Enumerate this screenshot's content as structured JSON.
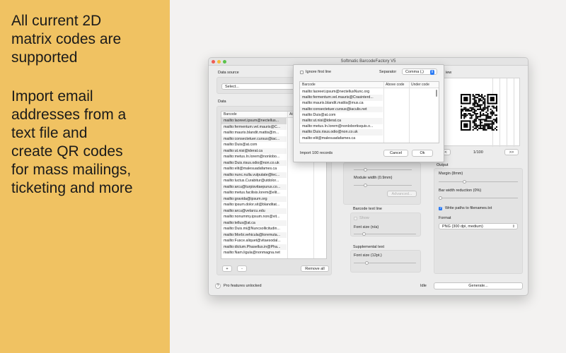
{
  "promo": {
    "headline": "All current 2D\nmatrix codes are\nsupported",
    "body": "Import email\naddresses from a\ntext file and\ncreate QR codes\nfor mass mailings,\nticketing and more"
  },
  "window": {
    "title": "Softmatic BarcodeFactory V5",
    "data_source_label": "Data source",
    "data_source_value": "Select...",
    "data_label": "Data",
    "table_headers": [
      "Barcode",
      "Ab"
    ],
    "rows": [
      "mailto:laoreet.ipsum@nectellus...",
      "mailto:fermentum.vel.mauris@C...",
      "mailto:mauris.blandit.mattis@m...",
      "mailto:consectetuer.cursus@iac...",
      "mailto:Duis@at.com",
      "mailto:ut.nisi@iderat.ca",
      "mailto:metus.In.lorem@nonlobo...",
      "mailto:Duis.risus.odio@non.co.uk",
      "mailto:elit@malesuadafames.ca",
      "mailto:nunc.nulla.vulputate@lec...",
      "mailto:luctus.Curabitur@utdolor...",
      "mailto:arcu@turpisvitaepurus.co...",
      "mailto:metus.facilisis.lorem@elit...",
      "mailto:gravida@ipsum.org",
      "mailto:ipsum.dolor.sit@blanditat...",
      "mailto:arcu@velarcu.edu",
      "mailto:nonummy.ipsum.non@vit...",
      "mailto:tellus@at.ca",
      "mailto:Duis.mi@Nuncsollicitudin...",
      "mailto:Morbi.vehicula@loremuta...",
      "mailto:Fusce.aliquet@vitaesodal...",
      "mailto:dictum.Phasellus.in@Pha...",
      "mailto:Nam.ligula@nonmagna.net"
    ],
    "add_label": "+",
    "remove_label": "-",
    "remove_all_label": "Remove all",
    "module_width_label": "Module width (0.9mm)",
    "advanced_label": "Advanced...",
    "barcode_text_line_label": "Barcode text line",
    "show_label": "Show",
    "font_size_na_label": "Font size (n/a)",
    "supplemental_text_label": "Supplemental text",
    "font_size_12_label": "Font size (12pt.)",
    "preview_label": "iew",
    "page_counter": "1/100",
    "prev_label": "<",
    "next_label": ">>",
    "output_label": "Output",
    "margin_label": "Margin (8mm)",
    "bar_width_reduction_label": "Bar width reduction (0%)",
    "write_paths_label": "Write paths to filenames.txt",
    "format_label": "Format",
    "format_value": "PNG (300 dpi, medium)",
    "pro_label": "Pro features unlocked",
    "status": "Idle",
    "generate_label": "Generate...",
    "help_label": "?"
  },
  "sheet": {
    "ignore_first_line_label": "Ignore first line",
    "separator_label": "Separator",
    "separator_value": "Comma (,)",
    "headers": [
      "Barcode",
      "Above code",
      "Under code"
    ],
    "rows": [
      "mailto:laoreet.ipsum@nectellusNunc.org",
      "mailto:fermentum.vel.mauris@Crasinterd...",
      "mailto:mauris.blandit.mattis@mus.ca",
      "mailto:consectetuer.cursus@iaculis.net",
      "mailto:Duis@at.com",
      "mailto:ut.nisi@iderat.ca",
      "mailto:metus.In.lorem@nonlobortisquis.o...",
      "mailto:Duis.risus.odio@non.co.uk",
      "mailto:elit@malesuadafames.ca"
    ],
    "import_status": "Import 100 records",
    "cancel_label": "Cancel",
    "ok_label": "Ok"
  },
  "colors": {
    "promo_background": "#f0c262",
    "accent": "#2a7af4"
  }
}
